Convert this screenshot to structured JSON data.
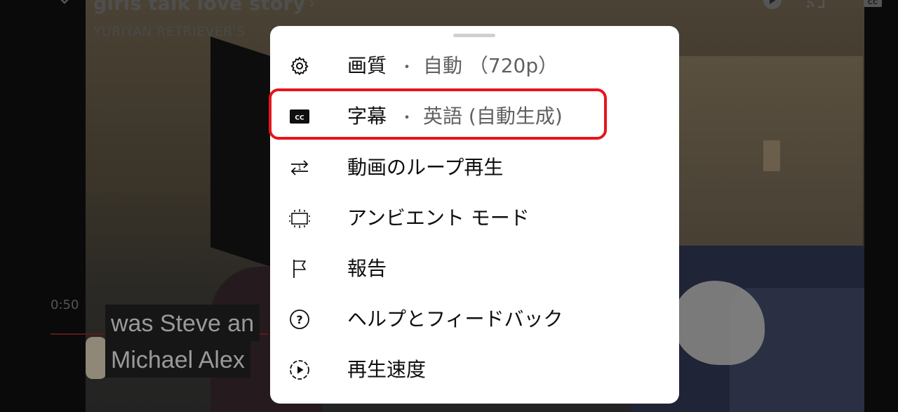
{
  "video": {
    "title": "girls talk love story",
    "channel": "YURIYAN RETRIEVER'S",
    "time": "0:50",
    "captions": [
      "was Steve an",
      "Michael Alex"
    ]
  },
  "menu": {
    "items": [
      {
        "icon": "gear-icon",
        "label": "画質",
        "separator": "・",
        "value": "自動 （720p）"
      },
      {
        "icon": "closed-captions-icon",
        "label": "字幕",
        "separator": "・",
        "value": "英語 (自動生成)"
      },
      {
        "icon": "loop-icon",
        "label": "動画のループ再生"
      },
      {
        "icon": "ambient-mode-icon",
        "label": "アンビエント モード"
      },
      {
        "icon": "flag-icon",
        "label": "報告"
      },
      {
        "icon": "help-icon",
        "label": "ヘルプとフィードバック"
      },
      {
        "icon": "playback-speed-icon",
        "label": "再生速度"
      }
    ],
    "highlight_color": "#e8141b"
  }
}
